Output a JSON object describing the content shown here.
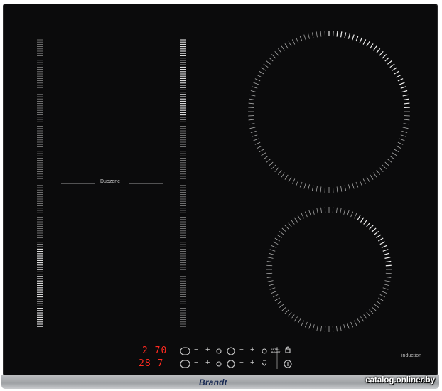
{
  "hob": {
    "duozone_label": "Duozone",
    "induction_label": "induction",
    "brand": "Brandt"
  },
  "controls": {
    "display_top": "2 70",
    "display_bottom": "28 7",
    "minus_symbol": "−",
    "plus_symbol": "+",
    "ultra_label": "ULTRA BOOST"
  },
  "watermark": "catalog.onliner.by",
  "colors": {
    "glass": "#0b0b0c",
    "frame": "#a9acaf",
    "display": "#ff2a20",
    "brand": "#1b2c55"
  }
}
